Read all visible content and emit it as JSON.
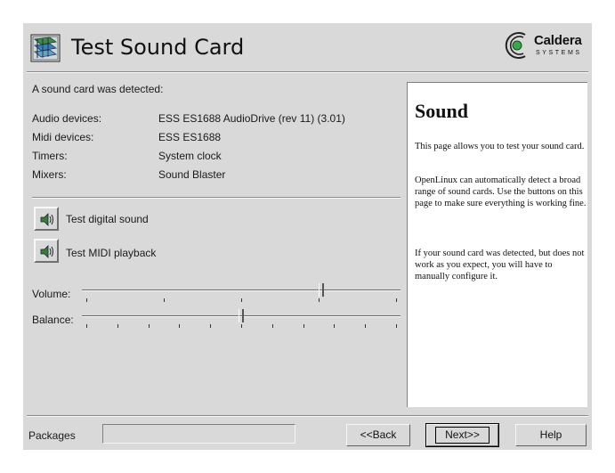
{
  "window": {
    "title": "Test Sound Card"
  },
  "logo": {
    "name": "Caldera",
    "sub": "SYSTEMS"
  },
  "main": {
    "detected_text": "A sound card was detected:",
    "devices": [
      {
        "label": "Audio devices:",
        "value": "ESS ES1688 AudioDrive (rev 11) (3.01)"
      },
      {
        "label": "Midi devices:",
        "value": "ESS ES1688"
      },
      {
        "label": "Timers:",
        "value": "System clock"
      },
      {
        "label": "Mixers:",
        "value": "Sound Blaster"
      }
    ],
    "buttons": {
      "test_digital": "Test digital sound",
      "test_midi": "Test MIDI playback"
    },
    "volume": {
      "label": "Volume:",
      "value_fraction": 0.75
    },
    "balance": {
      "label": "Balance:",
      "value_fraction": 0.5
    }
  },
  "help": {
    "title": "Sound",
    "paragraphs": [
      "This page allows you to test your sound card.",
      "OpenLinux can automatically detect a broad range of sound cards. Use the buttons on this page to make sure everything is working fine.",
      "If your sound card was detected, but does not work as you expect, you will have to manually configure it."
    ]
  },
  "footer": {
    "packages_label": "Packages",
    "packages_value": "",
    "back_label": "<<Back",
    "next_label": "Next>>",
    "help_label": "Help"
  },
  "icons": {
    "app": "sound-card-icon",
    "speaker": "speaker-icon",
    "logo_mark": "caldera-logo-icon"
  },
  "colors": {
    "window_bg": "#d9d9d9",
    "help_bg": "#ffffff",
    "logo_green": "#3aa64a"
  }
}
